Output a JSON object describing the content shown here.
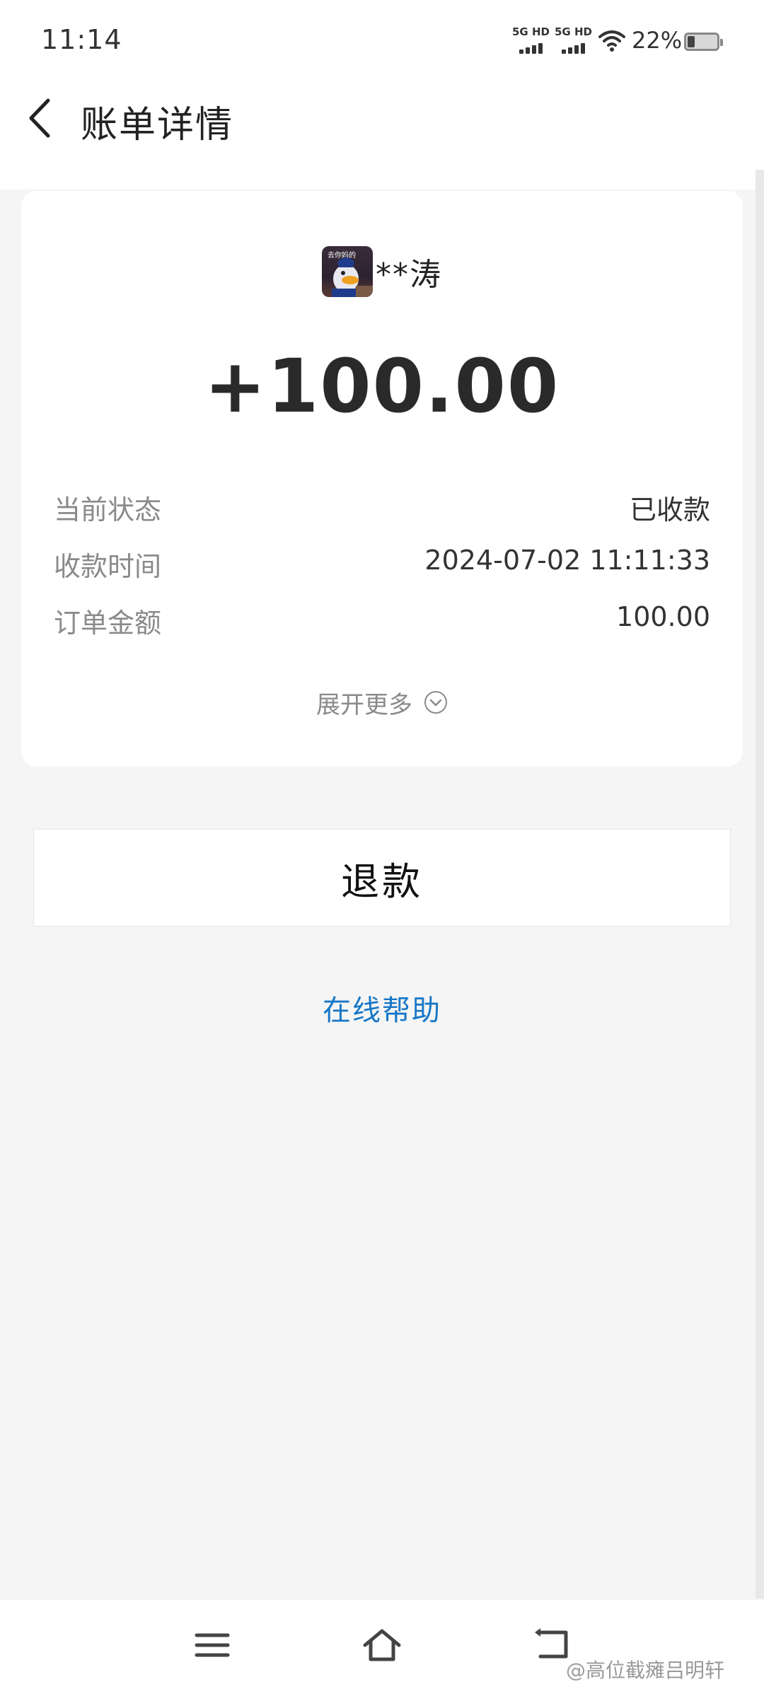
{
  "status_bar": {
    "time": "11:14",
    "sim1_label": "5G HD",
    "sim2_label": "5G HD",
    "battery_percent": "22%",
    "battery_level": 0.22,
    "icons": [
      "signal-icon",
      "wifi-icon",
      "battery-icon"
    ]
  },
  "header": {
    "title": "账单详情",
    "back_icon": "back-arrow-icon"
  },
  "bill": {
    "payer_name": "**涛",
    "avatar_caption": "去你妈的",
    "amount": "+100.00",
    "rows": [
      {
        "label": "当前状态",
        "value": "已收款"
      },
      {
        "label": "收款时间",
        "value": "2024-07-02 11:11:33"
      },
      {
        "label": "订单金额",
        "value": "100.00"
      }
    ],
    "expand_label": "展开更多"
  },
  "actions": {
    "refund_label": "退款",
    "help_label": "在线帮助"
  },
  "nav_bar": {
    "icons": [
      "menu-icon",
      "home-icon",
      "back-icon"
    ]
  },
  "watermark": "@高位截瘫吕明轩",
  "colors": {
    "link": "#1677c7",
    "background": "#f5f5f5",
    "card": "#ffffff"
  }
}
